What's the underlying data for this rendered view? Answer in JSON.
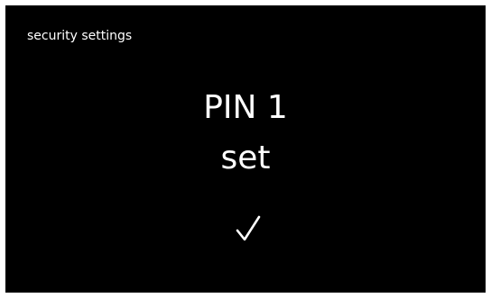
{
  "header": {
    "title": "security settings"
  },
  "message": {
    "line1": "PIN 1",
    "line2": "set"
  },
  "status": {
    "icon": "checkmark-icon"
  },
  "colors": {
    "background": "#000000",
    "text": "#ffffff"
  }
}
